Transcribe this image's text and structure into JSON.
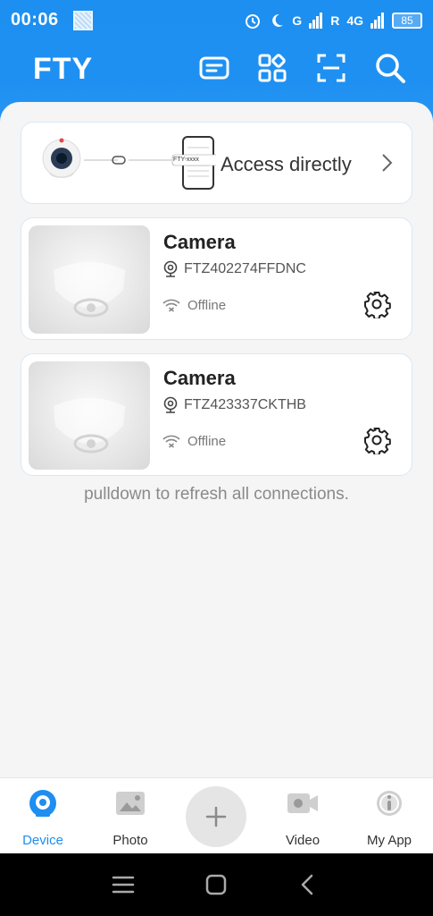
{
  "status_bar": {
    "time": "00:06",
    "net1": "G",
    "net2": "R",
    "net3": "4G",
    "battery": "85"
  },
  "header": {
    "title": "FTY",
    "icons": [
      "list-card-icon",
      "grid-icon",
      "scan-icon",
      "search-icon"
    ]
  },
  "access": {
    "label": "Access directly",
    "phone_text": "FTY-xxxx"
  },
  "devices": [
    {
      "name": "Camera",
      "id": "FTZ402274FFDNC",
      "status": "Offline"
    },
    {
      "name": "Camera",
      "id": "FTZ423337CKTHB",
      "status": "Offline"
    }
  ],
  "refresh_hint": "pulldown to refresh all connections.",
  "bottom_nav": {
    "items": [
      {
        "label": "Device",
        "active": true
      },
      {
        "label": "Photo",
        "active": false
      },
      {
        "label": "Video",
        "active": false
      },
      {
        "label": "My App",
        "active": false
      }
    ]
  },
  "colors": {
    "accent": "#1e8ef0",
    "header": "#1d8ff0",
    "background": "#f5f5f5"
  }
}
